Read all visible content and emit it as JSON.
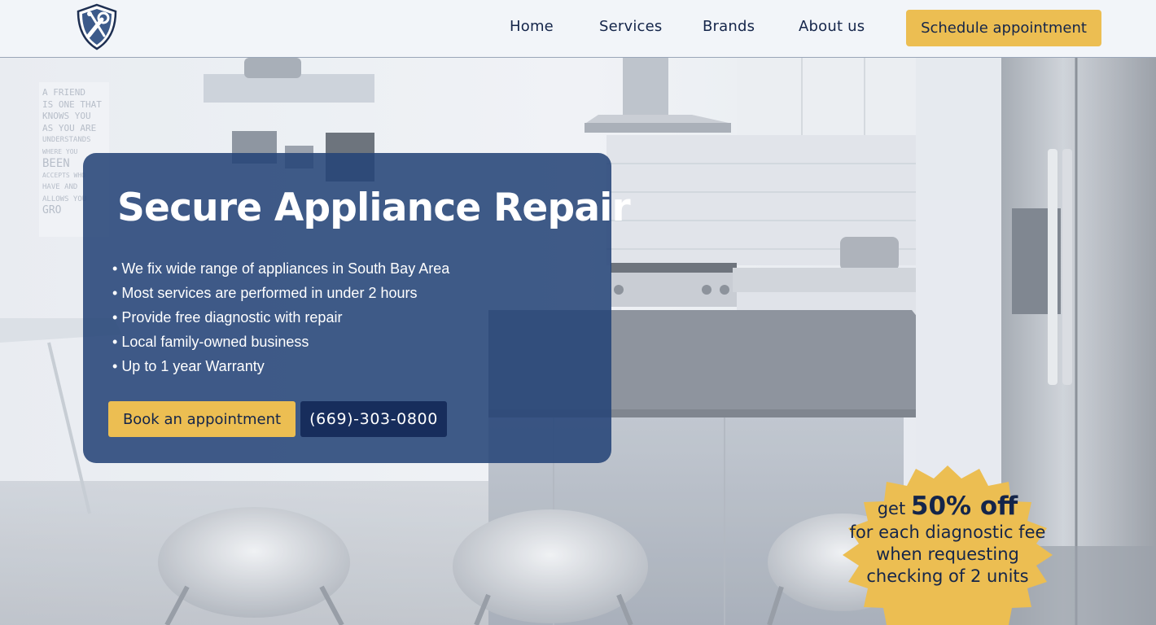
{
  "header": {
    "nav": [
      {
        "label": "Home"
      },
      {
        "label": "Services"
      },
      {
        "label": "Brands"
      },
      {
        "label": "About us"
      }
    ],
    "cta_label": "Schedule appointment"
  },
  "hero": {
    "title": "Secure Appliance Repair",
    "features": [
      "We fix wide range of appliances in South Bay Area",
      "Most services are performed in under 2 hours",
      "Provide free diagnostic with repair",
      "Local family-owned business",
      "Up to 1 year Warranty"
    ],
    "book_label": "Book an appointment",
    "phone_label": "(669)-303-0800"
  },
  "promo": {
    "get": "get",
    "discount": "50% off",
    "line2": "for each diagnostic fee",
    "line3": "when requesting",
    "line4": "checking of 2 units"
  },
  "wall_poster": {
    "lines": [
      "A FRIEND",
      "IS ONE THAT",
      "KNOWS YOU",
      "AS YOU ARE",
      "UNDERSTANDS",
      "WHERE YOU",
      "BEEN",
      "ACCEPTS WHO",
      "HAVE AND",
      "ALLOWS YOU",
      "GRO"
    ]
  },
  "colors": {
    "header_bg": "#f2f5f9",
    "accent_yellow": "#ecbe52",
    "card_blue": "#254478",
    "dark_navy": "#14254a"
  },
  "icons": {
    "logo": "shield-wrench-logo"
  }
}
